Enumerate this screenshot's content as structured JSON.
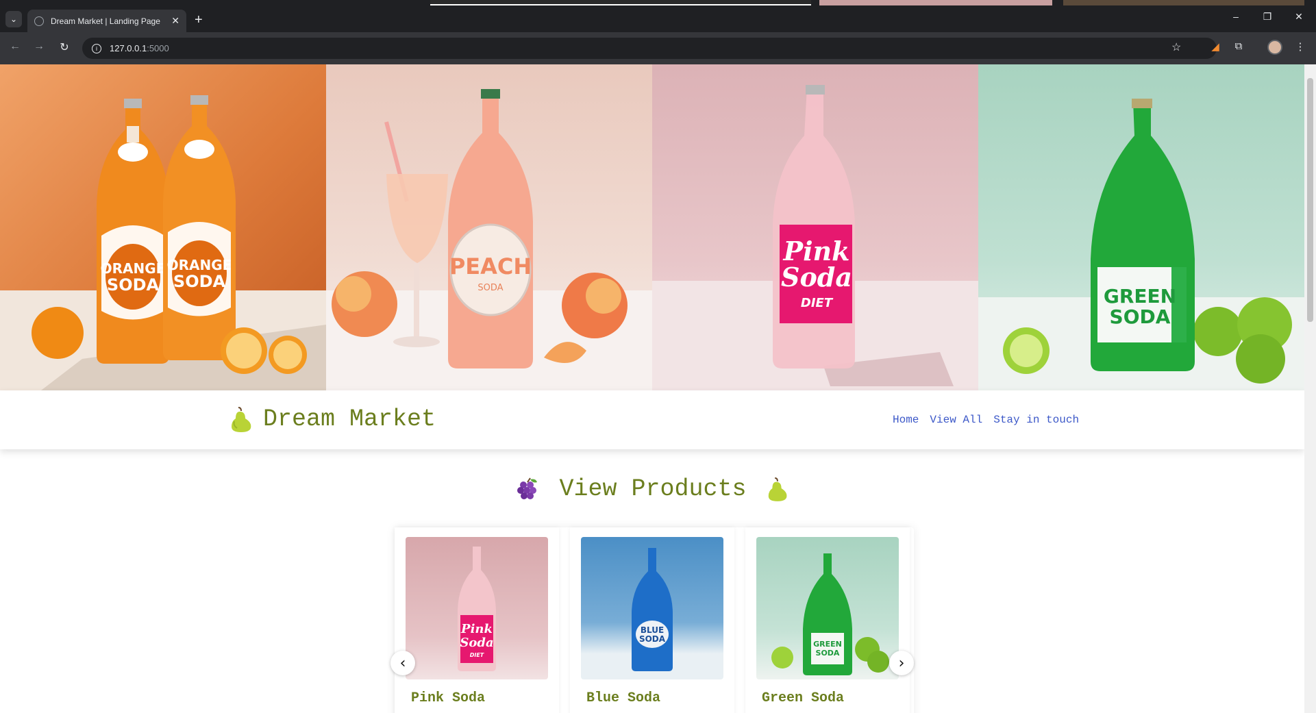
{
  "browser": {
    "tab_title": "Dream Market | Landing Page",
    "new_tab": "+",
    "tab_close": "✕",
    "url_host": "127.0.0.1",
    "url_port": ":5000",
    "window_controls": {
      "minimize": "–",
      "restore": "❐",
      "close": "✕"
    },
    "nav": {
      "back": "←",
      "forward": "→",
      "reload": "↻"
    }
  },
  "hero": {
    "panels": [
      {
        "label_line1": "ORANGE",
        "label_line2": "SODA",
        "name": "orange-soda"
      },
      {
        "label_line1": "PEACH",
        "label_line2": "SODA",
        "name": "peach-soda"
      },
      {
        "label_line1": "Pink",
        "label_line2": "Soda",
        "label_line3": "DIET",
        "name": "pink-soda"
      },
      {
        "label_line1": "GREEN",
        "label_line2": "SODA",
        "name": "green-soda"
      }
    ]
  },
  "header": {
    "brand": "Dream Market",
    "logo_icon": "pear-icon",
    "nav": [
      "Home",
      "View All",
      "Stay in touch"
    ]
  },
  "products": {
    "title": "View Products",
    "left_icon": "grapes-icon",
    "right_icon": "pear-icon",
    "prev": "‹",
    "next": "›",
    "items": [
      {
        "name": "Pink Soda",
        "label1": "Pink",
        "label2": "Soda",
        "label3": "DIET"
      },
      {
        "name": "Blue Soda",
        "label1": "BLUE",
        "label2": "SODA"
      },
      {
        "name": "Green Soda",
        "label1": "GREEN",
        "label2": "SODA"
      }
    ]
  },
  "colors": {
    "brand_green": "#6b7e1e",
    "link_blue": "#3c58c8",
    "chrome_dark": "#1f2023",
    "chrome_toolbar": "#35363a"
  }
}
